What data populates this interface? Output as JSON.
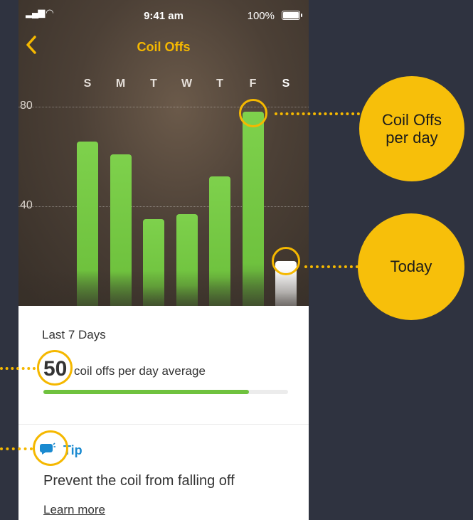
{
  "status_bar": {
    "time": "9:41 am",
    "battery": "100%"
  },
  "header": {
    "title": "Coil Offs",
    "back_icon": "chevron-left-icon"
  },
  "chart_data": {
    "type": "bar",
    "categories": [
      "S",
      "M",
      "T",
      "W",
      "T",
      "F",
      "S"
    ],
    "values": [
      66,
      61,
      35,
      37,
      52,
      78,
      18
    ],
    "highlight_index": 5,
    "today_index": 6,
    "y_ticks": [
      "80",
      "40"
    ],
    "bar_color": "#6fc23e",
    "today_color": "#ffffff"
  },
  "summary": {
    "period_label": "Last 7 Days",
    "average_value": "50",
    "average_label": "coil offs per day average",
    "progress_fraction": 0.84,
    "progress_color": "#6fc23e"
  },
  "tip": {
    "label": "Tip",
    "text": "Prevent the coil from falling off",
    "link": "Learn more",
    "icon": "speech-bubble-icon"
  },
  "callouts": {
    "per_day": "Coil Offs per day",
    "today": "Today"
  },
  "colors": {
    "accent": "#f5b800",
    "callout": "#f7bf0a",
    "tip": "#1a8ad0",
    "background": "#2f3340"
  }
}
